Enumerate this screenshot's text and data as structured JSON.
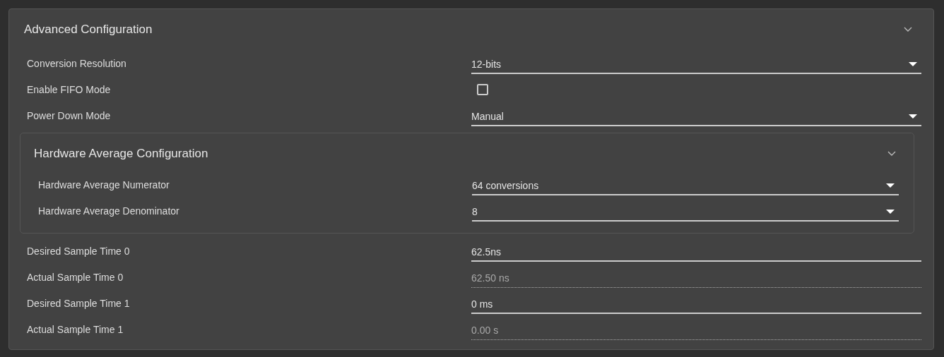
{
  "section": {
    "title": "Advanced Configuration",
    "expanded": true,
    "items": [
      {
        "kind": "select",
        "label": "Conversion Resolution",
        "value": "12-bits"
      },
      {
        "kind": "checkbox",
        "label": "Enable FIFO Mode",
        "checked": false
      },
      {
        "kind": "select",
        "label": "Power Down Mode",
        "value": "Manual"
      },
      {
        "kind": "group",
        "title": "Hardware Average Configuration",
        "expanded": true,
        "items": [
          {
            "kind": "select",
            "label": "Hardware Average Numerator",
            "value": "64 conversions"
          },
          {
            "kind": "select",
            "label": "Hardware Average Denominator",
            "value": "8"
          }
        ]
      },
      {
        "kind": "text",
        "label": "Desired Sample Time 0",
        "value": "62.5ns"
      },
      {
        "kind": "readonly",
        "label": "Actual Sample Time 0",
        "value": "62.50 ns"
      },
      {
        "kind": "text",
        "label": "Desired Sample Time 1",
        "value": "0 ms"
      },
      {
        "kind": "readonly",
        "label": "Actual Sample Time 1",
        "value": "0.00 s"
      }
    ]
  }
}
